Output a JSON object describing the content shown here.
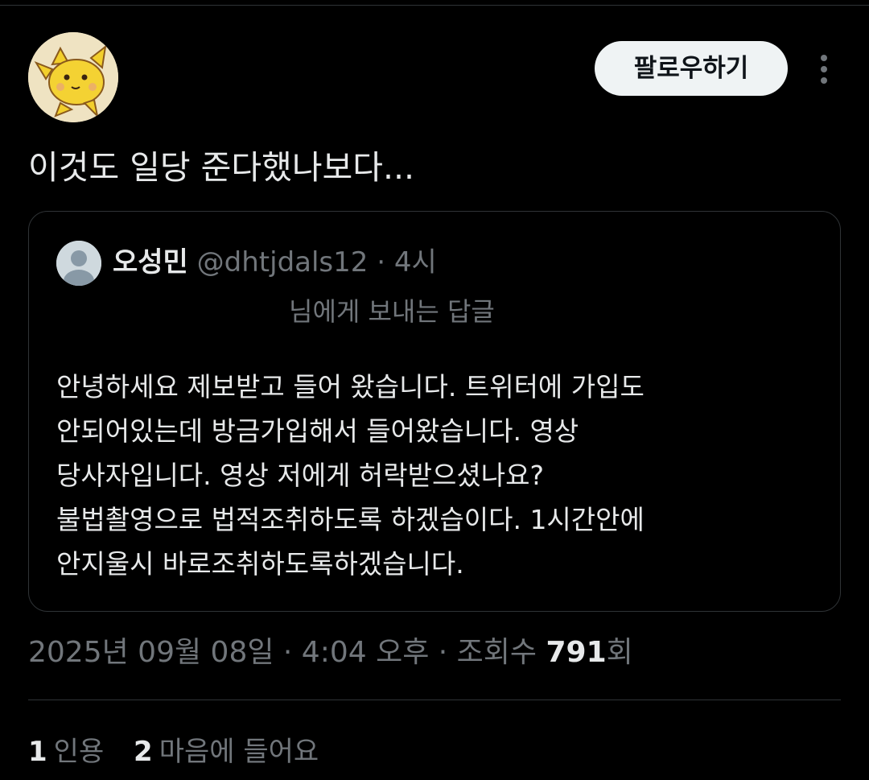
{
  "post": {
    "text": "이것도 일당 준다했나보다...",
    "follow_label": "팔로우하기",
    "avatar_icon": "pikachu-avatar",
    "more_icon": "more-vertical-icon"
  },
  "quote": {
    "name": "오성민",
    "handle": "@dhtjdals12",
    "separator": "·",
    "time": "4시",
    "replying_to": "님에게 보내는 답글",
    "avatar_icon": "default-profile-avatar",
    "body_lines": [
      "안녕하세요 제보받고 들어 왔습니다. 트위터에 가입도",
      "안되어있는데 방금가입해서 들어왔습니다. 영상",
      "당사자입니다. 영상 저에게 허락받으셨나요?",
      "불법촬영으로 법적조취하도록 하겠습이다. 1시간안에",
      "안지울시 바로조취하도록하겠습니다."
    ]
  },
  "meta": {
    "date_time": "2025년 09월 08일 · 4:04 오후 · 조회수 ",
    "views_count": "791",
    "views_suffix": "회"
  },
  "stats": {
    "quotes_count": "1",
    "quotes_label": "인용",
    "likes_count": "2",
    "likes_label": "마음에 들어요"
  },
  "colors": {
    "background": "#000000",
    "text_primary": "#e7e9ea",
    "text_secondary": "#71767b",
    "border": "#2f3336",
    "follow_bg": "#eff3f4"
  }
}
